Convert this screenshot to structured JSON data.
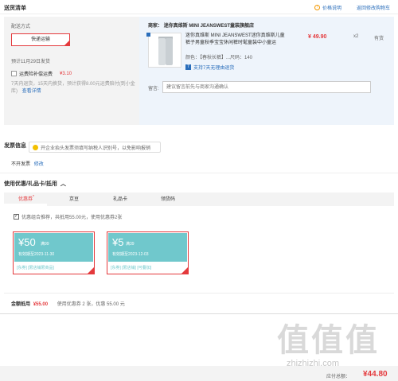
{
  "header": {
    "title": "送货清单",
    "price_help": "价格说明",
    "back_to_cart": "返回修改购物车"
  },
  "delivery": {
    "method_label": "配送方式",
    "method_value": "快递运输",
    "ship_date": "预计11月29日发货",
    "freight_insurance_label": "运费险补偿运费",
    "freight_insurance_price": "¥3.10",
    "insurance_desc": "7天内退货，15天内换货，预计获得8.00元运费赔付(到小金库)",
    "insurance_link": "查看详情"
  },
  "order": {
    "shop_prefix": "商家：",
    "shop_name": "迷你真维斯 MINI JEANSWEST童装旗舰店",
    "product_name": "迷你真维斯 MINI JEANSWEST迷你真维斯儿童裤子男童秋季宝宝休闲裤时髦童装中小童运",
    "product_price": "¥ 49.90",
    "product_qty": "x2",
    "product_stock": "有货",
    "spec": "颜色：【春秋长裤】...尺码：140",
    "return_support": "支持7天无理由退货",
    "note_label": "留言:",
    "note_placeholder": "建议留言前先与商家沟通确认"
  },
  "invoice": {
    "title": "发票信息",
    "tip": "开企业抬头发票须填写纳税人识别号，以免影响报销",
    "status": "不开发票",
    "modify": "修改"
  },
  "coupons": {
    "section_title": "使用优惠/礼品卡/抵用",
    "tabs": [
      "优惠券",
      "京豆",
      "礼品卡",
      "领货码"
    ],
    "tab_badge": "*",
    "auto_optimize": "优惠组合推荐，共抵用55.00元，使用优惠券2张",
    "items": [
      {
        "amount": "¥50",
        "condition": "满99",
        "valid": "有效期至2023-11-30",
        "tags": "[东券] [限店铺限商品]"
      },
      {
        "amount": "¥5",
        "condition": "满39",
        "valid": "有效期至2023-12-03",
        "tags": "[东券] [限店铺] [可叠加]"
      }
    ],
    "summary_label": "金额抵用",
    "summary_amount": "¥55.00",
    "summary_desc": "使用优惠券 2 张，优惠 55.00 元"
  },
  "totals": {
    "label": "应付总额：",
    "value": "¥44.80"
  },
  "watermark": {
    "text": "值值值",
    "site": "zhizhizhi.com"
  },
  "colors": {
    "accent_red": "#e4393c",
    "link_blue": "#2a6ebb",
    "coupon_teal": "#70c8cc"
  }
}
